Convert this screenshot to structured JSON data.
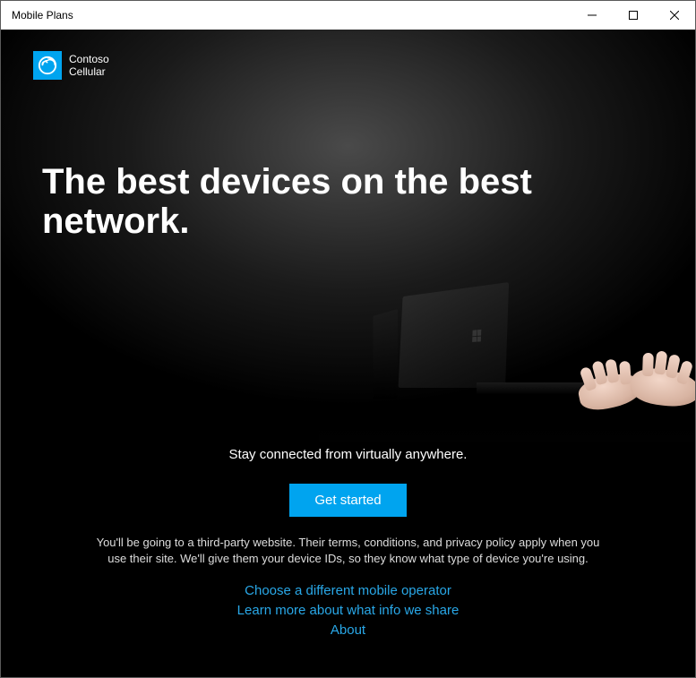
{
  "window": {
    "title": "Mobile Plans"
  },
  "brand": {
    "name": "Contoso\nCellular"
  },
  "hero": {
    "headline": "The best devices on the best network."
  },
  "tagline": "Stay connected from virtually anywhere.",
  "cta": {
    "label": "Get started"
  },
  "disclaimer": "You'll be going to a third-party website. Their terms, conditions, and privacy policy apply when you use their site. We'll give them your device IDs, so they know what type of device you're using.",
  "links": {
    "choose_operator": "Choose a different mobile operator",
    "learn_more": "Learn more about what info we share",
    "about": "About"
  },
  "colors": {
    "accent": "#00A4EF",
    "link": "#29a8e8"
  }
}
